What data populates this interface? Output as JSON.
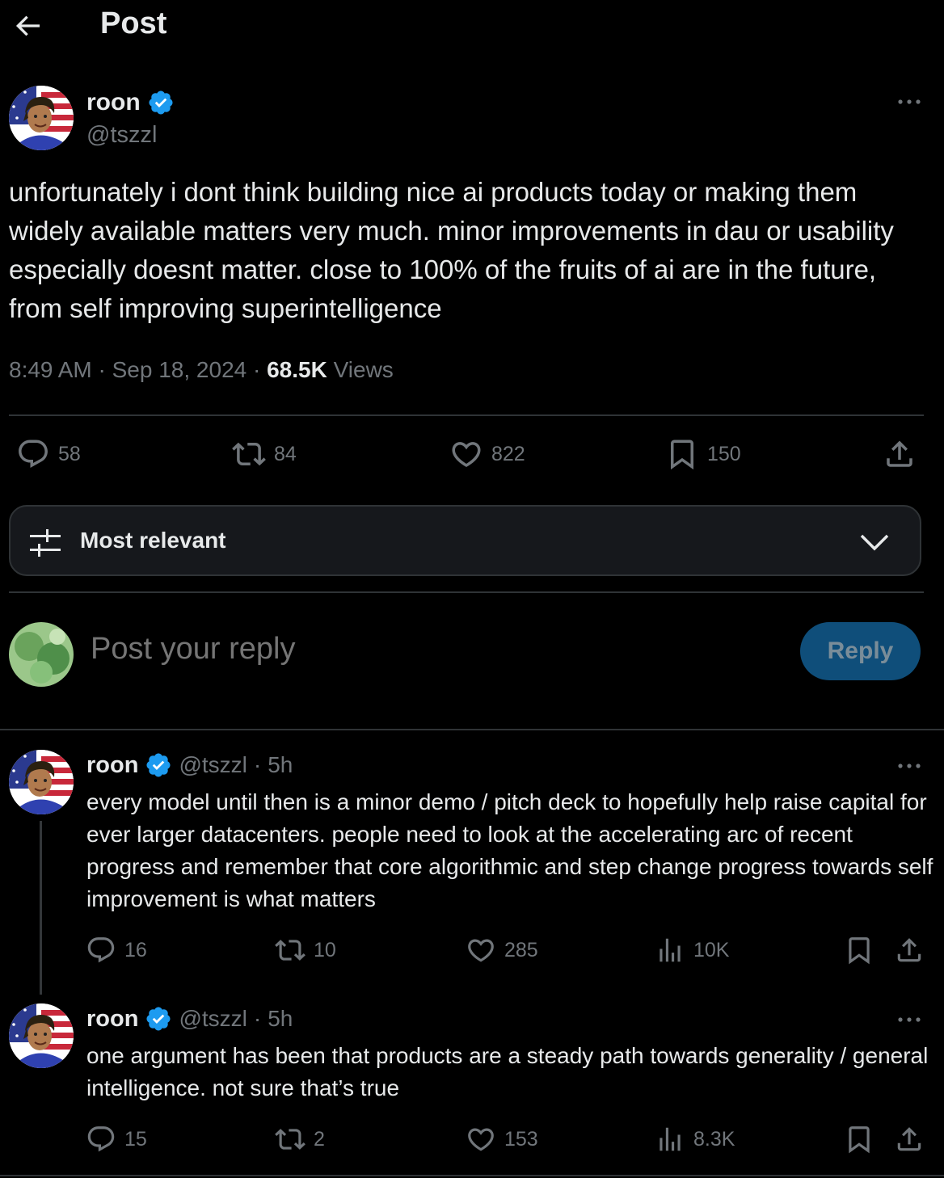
{
  "header": {
    "title": "Post"
  },
  "colors": {
    "accent": "#1d9bf0",
    "background": "#000000",
    "muted": "#71767b",
    "divider": "#2f3336"
  },
  "post": {
    "author_name": "roon",
    "handle": "@tszzl",
    "text": "unfortunately i dont think building nice ai products today or making them widely available matters very much. minor improvements in dau or usability especially doesnt matter. close to 100% of the fruits of ai are in the future, from self improving superintelligence",
    "time": "8:49 AM",
    "date": "Sep 18, 2024",
    "views_count": "68.5K",
    "views_label": "Views",
    "replies": "58",
    "reposts": "84",
    "likes": "822",
    "bookmarks": "150"
  },
  "sort": {
    "label": "Most relevant"
  },
  "composer": {
    "placeholder": "Post your reply",
    "button_label": "Reply"
  },
  "replies": [
    {
      "author_name": "roon",
      "handle": "@tszzl",
      "time": "5h",
      "text": "every model until then is a minor demo / pitch deck to hopefully help raise capital for ever larger datacenters. people need to look at the accelerating arc of recent progress and remember that core algorithmic and step change progress towards self improvement is what matters",
      "replies": "16",
      "reposts": "10",
      "likes": "285",
      "views": "10K"
    },
    {
      "author_name": "roon",
      "handle": "@tszzl",
      "time": "5h",
      "text": "one argument has been that products are a steady path towards generality / general intelligence. not sure that’s true",
      "replies": "15",
      "reposts": "2",
      "likes": "153",
      "views": "8.3K"
    }
  ]
}
